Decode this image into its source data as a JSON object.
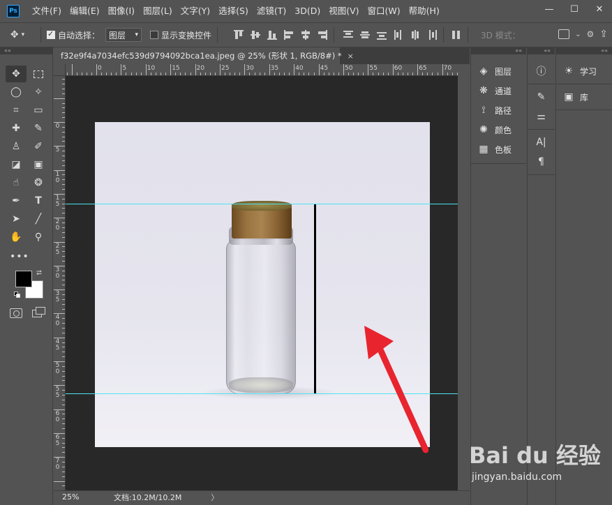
{
  "app": {
    "logo": "Ps"
  },
  "menu": [
    "文件(F)",
    "编辑(E)",
    "图像(I)",
    "图层(L)",
    "文字(Y)",
    "选择(S)",
    "滤镜(T)",
    "3D(D)",
    "视图(V)",
    "窗口(W)",
    "帮助(H)"
  ],
  "window_controls": {
    "minimize": "—",
    "maximize": "☐",
    "close": "✕"
  },
  "options": {
    "auto_select_label": "自动选择：",
    "auto_select_checked": true,
    "auto_select_target": "图层",
    "show_transform_label": "显示变换控件",
    "show_transform_checked": false,
    "mode_3d": "3D 模式："
  },
  "collapse_glyph": "««",
  "document": {
    "tab_title": "f32e9f4a7034efc539d9794092bca1ea.jpeg @ 25% (形状 1, RGB/8#) *",
    "close": "×"
  },
  "ruler": {
    "top_labels": [
      "0",
      "5",
      "10",
      "15",
      "20",
      "25",
      "30",
      "35",
      "40",
      "45",
      "50",
      "55",
      "60",
      "65",
      "70"
    ],
    "left_labels": [
      "0",
      "5",
      "1\n0",
      "1\n5",
      "2\n0",
      "2\n5",
      "3\n0",
      "3\n5",
      "4\n0",
      "4\n5",
      "5\n0",
      "5\n5",
      "6\n0",
      "6\n5",
      "7\n0"
    ]
  },
  "status": {
    "zoom": "25%",
    "doc_size": "文档:10.2M/10.2M",
    "arrow": "〉"
  },
  "panels": {
    "col1": [
      {
        "icon": "layers-icon",
        "label": "图层"
      },
      {
        "icon": "channels-icon",
        "label": "通道"
      },
      {
        "icon": "paths-icon",
        "label": "路径"
      },
      {
        "icon": "color-icon",
        "label": "颜色"
      },
      {
        "icon": "swatches-icon",
        "label": "色板"
      }
    ],
    "col3": [
      {
        "icon": "learn-icon",
        "label": "学习"
      },
      {
        "icon": "libraries-icon",
        "label": "库"
      }
    ]
  },
  "watermark": {
    "logo": "Bai du 经验",
    "url": "jingyan.baidu.com"
  },
  "colors": {
    "guide": "#4de3ef",
    "arrow": "#e8242e",
    "foreground": "#000000",
    "background": "#ffffff"
  }
}
